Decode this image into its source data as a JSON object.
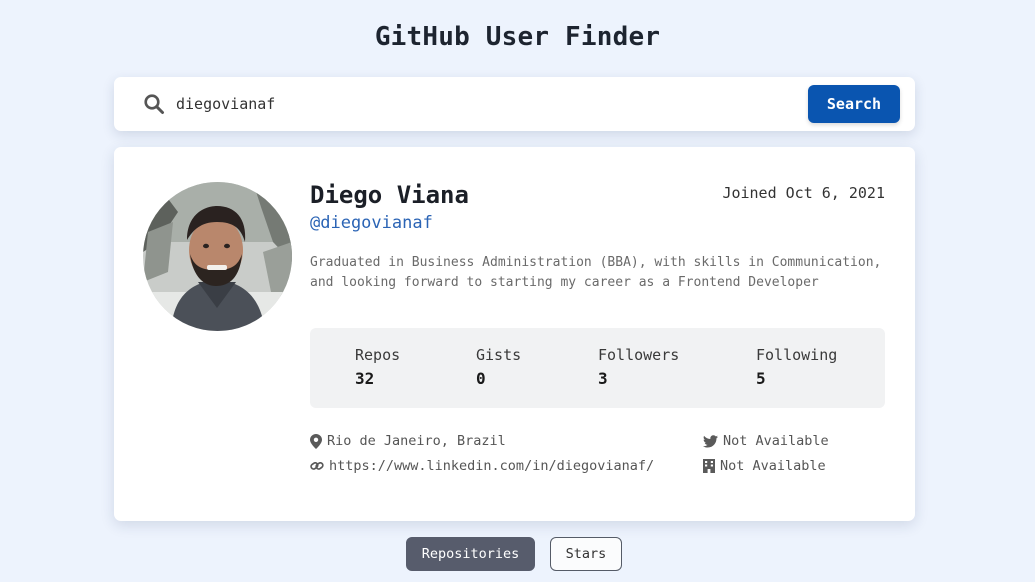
{
  "app": {
    "title": "GitHub User Finder"
  },
  "search": {
    "value": "diegovianaf",
    "button_label": "Search",
    "icon": "search-icon"
  },
  "profile": {
    "name": "Diego Viana",
    "login": "@diegovianaf",
    "joined": "Joined Oct 6, 2021",
    "bio": "Graduated in Business Administration (BBA), with skills in Communication, and looking forward to starting my career as a Frontend Developer",
    "stats": [
      {
        "label": "Repos",
        "value": "32"
      },
      {
        "label": "Gists",
        "value": "0"
      },
      {
        "label": "Followers",
        "value": "3"
      },
      {
        "label": "Following",
        "value": "5"
      }
    ],
    "location": "Rio de Janeiro, Brazil",
    "blog": "https://www.linkedin.com/in/diegovianaf/",
    "twitter": "Not Available",
    "company": "Not Available"
  },
  "tabs": [
    {
      "label": "Repositories",
      "active": true
    },
    {
      "label": "Stars",
      "active": false
    }
  ],
  "colors": {
    "background": "#edf3fd",
    "accent": "#0a55b0",
    "link": "#2b64b5",
    "active_tab": "#575c6c"
  }
}
